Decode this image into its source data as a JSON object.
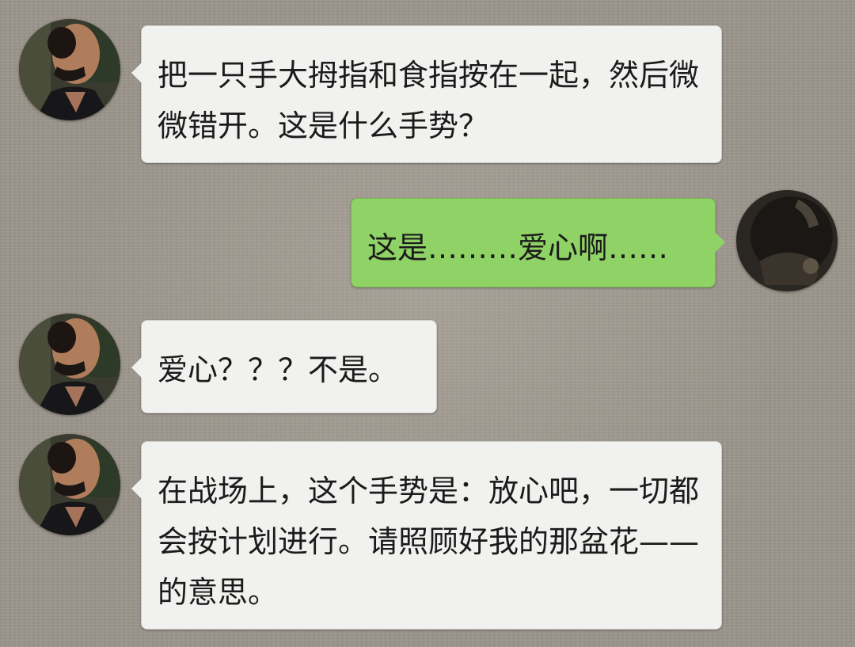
{
  "chat": {
    "messages": [
      {
        "sender": "other",
        "avatar_icon": "man-portrait-avatar",
        "text": "把一只手大拇指和食指按在一起，然后微微错开。这是什么手势？"
      },
      {
        "sender": "self",
        "avatar_icon": "dark-photo-avatar",
        "text": "这是………爱心啊……"
      },
      {
        "sender": "other",
        "avatar_icon": "man-portrait-avatar",
        "text": "爱心？？？不是。"
      },
      {
        "sender": "other",
        "avatar_icon": "man-portrait-avatar",
        "text": "在战场上，这个手势是：放心吧，一切都会按计划进行。请照顾好我的那盆花——的意思。"
      }
    ]
  },
  "colors": {
    "background": "#9a948b",
    "incoming_bubble": "#f1f1ef",
    "outgoing_bubble": "#8fd266",
    "text": "#1b1b1b"
  }
}
